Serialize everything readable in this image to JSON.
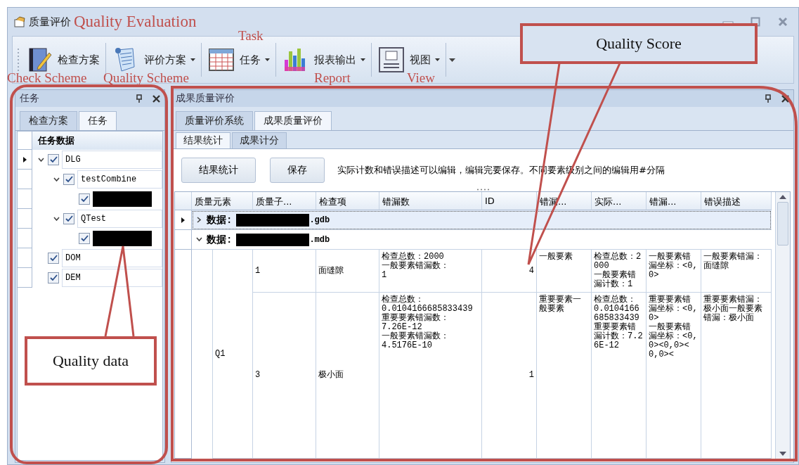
{
  "window": {
    "title": "质量评价",
    "title_annotation": "Quality Evaluation"
  },
  "toolbar": [
    {
      "label": "检查方案",
      "kind": "notebook",
      "dropdown": false,
      "annotation": "Check Scheme"
    },
    {
      "label": "评价方案",
      "kind": "scroll",
      "dropdown": true,
      "annotation": "Quality Scheme"
    },
    {
      "label": "任务",
      "kind": "table",
      "dropdown": true,
      "annotation": "Task"
    },
    {
      "label": "报表输出",
      "kind": "chart",
      "dropdown": true,
      "annotation": "Report"
    },
    {
      "label": "视图",
      "kind": "window",
      "dropdown": true,
      "annotation": "View"
    }
  ],
  "left_panel": {
    "title": "任务",
    "tabs": [
      {
        "label": "检查方案",
        "selected": false
      },
      {
        "label": "任务",
        "selected": true
      }
    ],
    "column": "任务数据",
    "tree": [
      {
        "label": "DLG",
        "checked": true,
        "expanded": true,
        "current": true,
        "children": [
          {
            "label": "testCombine",
            "checked": true,
            "expanded": true,
            "children": [
              {
                "kind": "redacted",
                "checked": true
              }
            ]
          },
          {
            "label": "QTest",
            "checked": true,
            "expanded": true,
            "children": [
              {
                "kind": "redacted",
                "checked": true
              }
            ]
          }
        ]
      },
      {
        "label": "DOM",
        "checked": true
      },
      {
        "label": "DEM",
        "checked": true
      }
    ]
  },
  "right_panel": {
    "title": "成果质量评价",
    "tabs": [
      {
        "label": "质量评价系统",
        "selected": false
      },
      {
        "label": "成果质量评价",
        "selected": true
      }
    ],
    "subtabs": [
      {
        "label": "结果统计",
        "selected": true
      },
      {
        "label": "成果计分",
        "selected": false
      }
    ],
    "buttons": [
      "结果统计",
      "保存"
    ],
    "hint": "实际计数和错误描述可以编辑，编辑完要保存。不同要素级别之间的编辑用#分隔",
    "columns": [
      "质量元素",
      "质量子...",
      "检查项",
      "错漏数",
      "ID",
      "错漏...",
      "实际...",
      "错漏...",
      "错误描述"
    ],
    "groups": [
      {
        "label": "数据:",
        "suffix": ".gdb",
        "expanded": false,
        "selected": true
      },
      {
        "label": "数据:",
        "suffix": ".mdb",
        "expanded": true,
        "selected": false,
        "children": [
          {
            "element": "Q1",
            "items": [
              {
                "sub": "1",
                "item": "面缝隙",
                "counts": "检查总数：2000\n一般要素错漏数：\n1",
                "id": "4",
                "level": "一般要素",
                "actual": "检查总数：2000\n一般要素错漏计数：1",
                "coords": "一般要素错漏坐标：<0,0>",
                "desc": "一般要素错漏：面缝隙"
              },
              {
                "sub": "3",
                "item": "极小面",
                "counts": "检查总数：\n0.0104166685833439\n重要要素错漏数：\n7.26E-12\n一般要素错漏数：\n4.5176E-10",
                "id": "1",
                "level": "重要要素一般要素",
                "actual": "检查总数：0.0104166685833439\n重要要素错漏计数：7.26E-12",
                "coords": "重要要素错漏坐标：<0,0>\n一般要素错漏坐标：<0,0><0,0><0,0><",
                "desc": "重要要素错漏：极小面一般要素错漏：极小面"
              }
            ]
          }
        ]
      }
    ]
  },
  "callouts": [
    {
      "text": "Quality Score"
    },
    {
      "text": "Quality data"
    }
  ]
}
